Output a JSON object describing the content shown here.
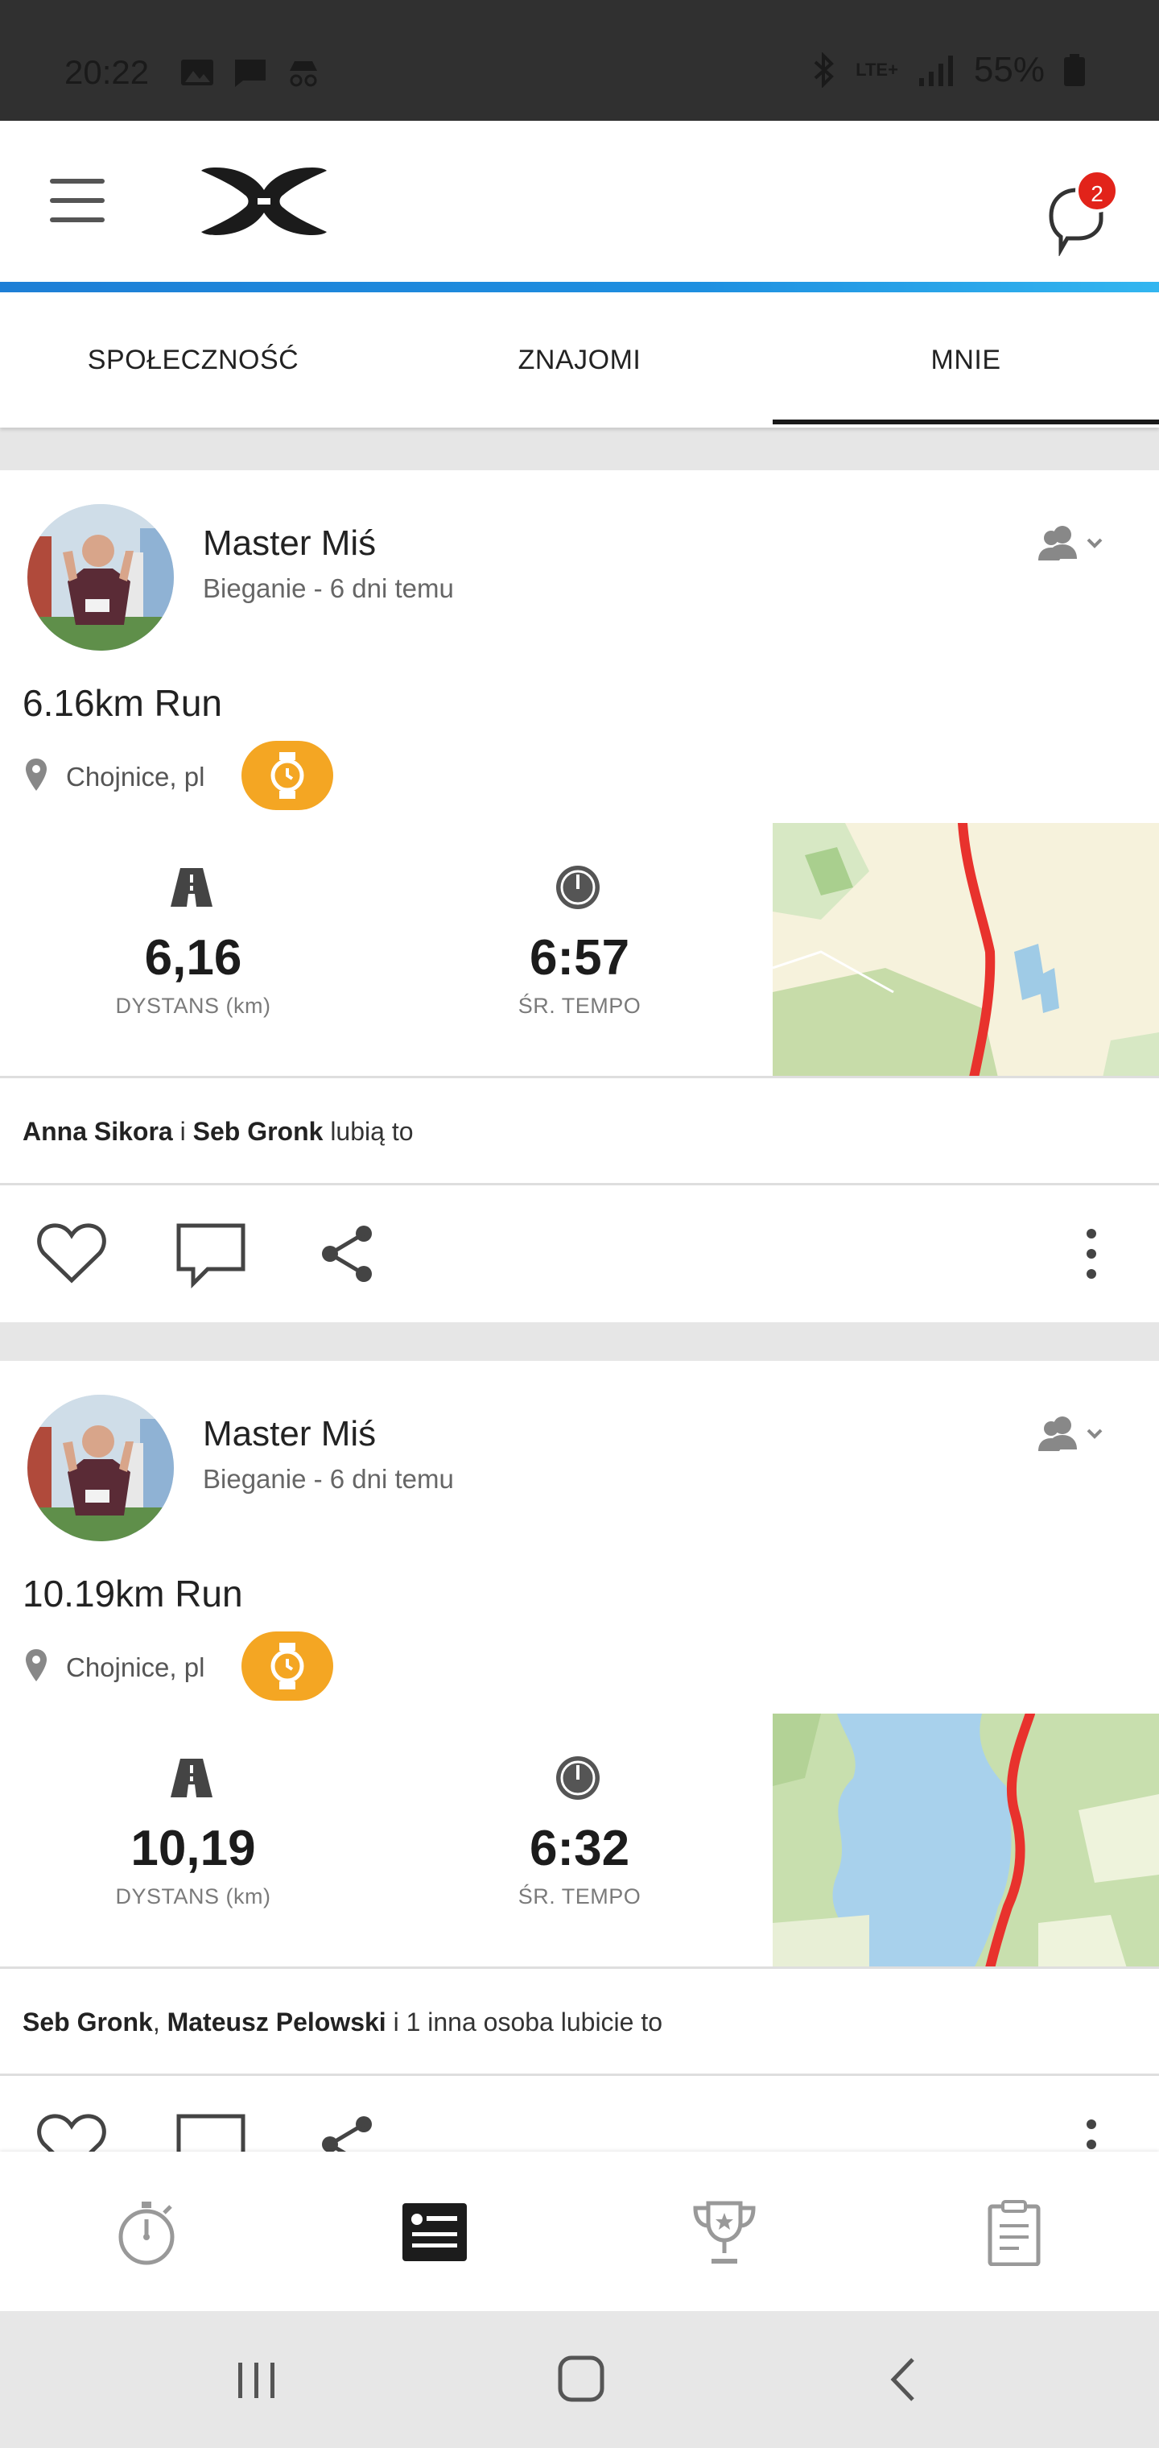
{
  "status_bar": {
    "time": "20:22",
    "battery": "55%",
    "network": "LTE+"
  },
  "header": {
    "brand": "Under Armour",
    "notification_count": "2"
  },
  "tabs": [
    {
      "label": "SPOŁECZNOŚĆ",
      "active": false
    },
    {
      "label": "ZNAJOMI",
      "active": false
    },
    {
      "label": "MNIE",
      "active": true
    }
  ],
  "feed": [
    {
      "user_name": "Master Miś",
      "subtitle": "Bieganie - 6 dni temu",
      "title": "6.16km Run",
      "location": "Chojnice, pl",
      "stats": [
        {
          "value": "6,16",
          "label": "DYSTANS  (km)",
          "icon": "road-icon"
        },
        {
          "value": "6:57",
          "label": "ŚR. TEMPO",
          "icon": "speedometer-icon"
        }
      ],
      "likes": {
        "names": [
          "Anna Sikora",
          "Seb Gronk"
        ],
        "connector": " i ",
        "suffix": " lubią to"
      }
    },
    {
      "user_name": "Master Miś",
      "subtitle": "Bieganie - 6 dni temu",
      "title": "10.19km Run",
      "location": "Chojnice, pl",
      "stats": [
        {
          "value": "10,19",
          "label": "DYSTANS  (km)",
          "icon": "road-icon"
        },
        {
          "value": "6:32",
          "label": "ŚR. TEMPO",
          "icon": "speedometer-icon"
        }
      ],
      "likes": {
        "names": [
          "Seb Gronk",
          "Mateusz Pelowski"
        ],
        "connector": ", ",
        "suffix": " i 1 inna osoba lubicie to"
      }
    }
  ],
  "bottom_nav": [
    {
      "icon": "stopwatch-icon",
      "active": false
    },
    {
      "icon": "feed-icon",
      "active": true
    },
    {
      "icon": "trophy-icon",
      "active": false
    },
    {
      "icon": "clipboard-icon",
      "active": false
    }
  ],
  "colors": {
    "accent_blue": "#1e7fd6",
    "device_badge": "#f4a623",
    "route_red": "#e8322d",
    "badge_red": "#e2231a"
  }
}
